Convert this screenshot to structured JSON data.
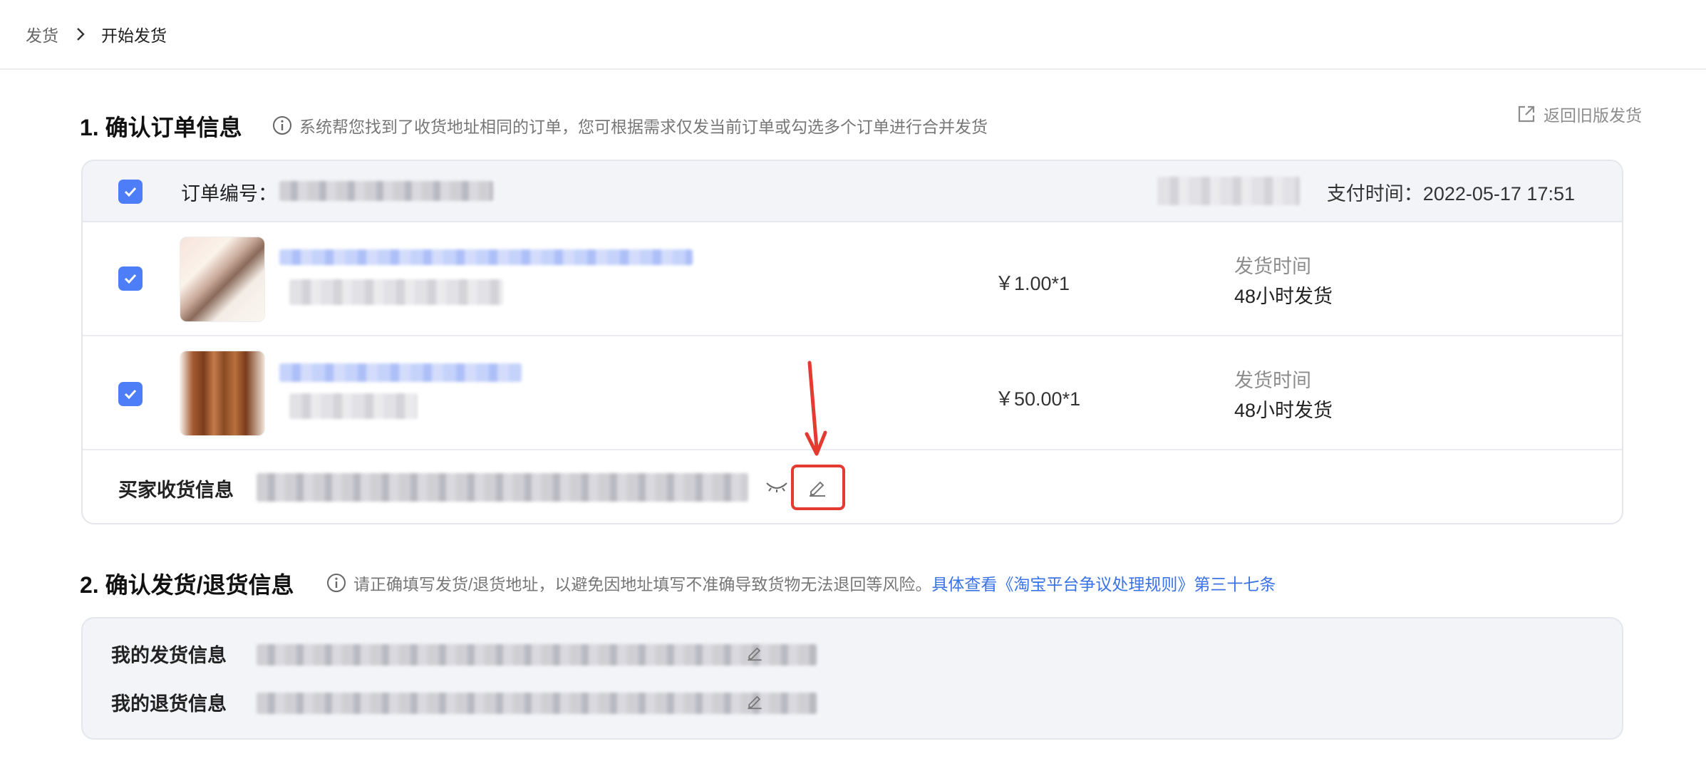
{
  "breadcrumb": {
    "root": "发货",
    "current": "开始发货"
  },
  "header_link": {
    "label": "返回旧版发货"
  },
  "section1": {
    "title": "1. 确认订单信息",
    "hint": "系统帮您找到了收货地址相同的订单，您可根据需求仅发当前订单或勾选多个订单进行合并发货"
  },
  "order": {
    "order_no_label": "订单编号：",
    "pay_time": "支付时间：2022-05-17 17:51",
    "items": [
      {
        "price": "￥1.00*1",
        "ship_label": "发货时间",
        "ship_value": "48小时发货",
        "checked": true
      },
      {
        "price": "￥50.00*1",
        "ship_label": "发货时间",
        "ship_value": "48小时发货",
        "checked": true
      }
    ],
    "buyer_label": "买家收货信息"
  },
  "section2": {
    "title": "2. 确认发货/退货信息",
    "hint": "请正确填写发货/退货地址，以避免因地址填写不准确导致货物无法退回等风险。",
    "link": "具体查看《淘宝平台争议处理规则》第三十七条"
  },
  "shipping": {
    "send_label": "我的发货信息",
    "return_label": "我的退货信息"
  },
  "colors": {
    "accent": "#4d7ef7",
    "link": "#3a73e6",
    "highlight": "#e43a30"
  },
  "icons": [
    "chevron-right-icon",
    "info-icon",
    "external-link-icon",
    "checkbox-checked-icon",
    "eye-closed-icon",
    "edit-pencil-icon",
    "arrow-down-icon"
  ]
}
